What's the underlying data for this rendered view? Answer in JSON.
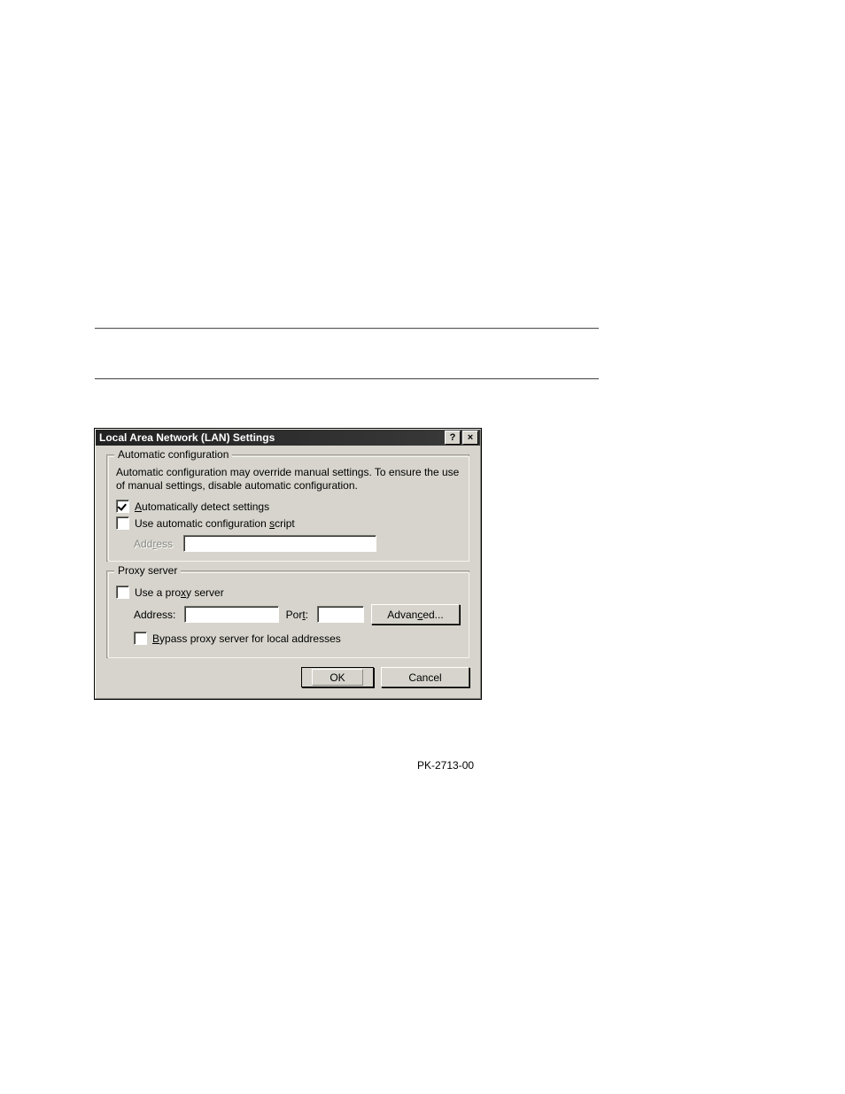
{
  "rules": {
    "hr1_visible": true,
    "hr2_visible": true
  },
  "dialog": {
    "title": "Local Area Network (LAN) Settings",
    "help_glyph": "?",
    "close_glyph": "×",
    "auto": {
      "legend": "Automatic configuration",
      "desc": "Automatic configuration may override manual settings.  To ensure the use of manual settings, disable automatic configuration.",
      "detect": {
        "label_pre": "",
        "accesskey": "A",
        "label_post": "utomatically detect settings",
        "checked": true
      },
      "script": {
        "label_pre": "Use automatic configuration ",
        "accesskey": "s",
        "label_post": "cript",
        "checked": false
      },
      "address_label_pre": "Add",
      "address_accesskey": "r",
      "address_label_post": "ess",
      "address_value": ""
    },
    "proxy": {
      "legend": "Proxy server",
      "use": {
        "label_pre": "Use a pro",
        "accesskey": "x",
        "label_post": "y server",
        "checked": false
      },
      "addr_label": "Address:",
      "addr_value": "",
      "port_label_pre": "Por",
      "port_accesskey": "t",
      "port_label_post": ":",
      "port_value": "",
      "advanced_pre": "Advan",
      "advanced_accesskey": "c",
      "advanced_post": "ed...",
      "bypass": {
        "accesskey": "B",
        "label_post": "ypass proxy server for local addresses",
        "checked": false
      }
    },
    "ok_label": "OK",
    "cancel_label": "Cancel"
  },
  "figure_id": "PK-2713-00"
}
